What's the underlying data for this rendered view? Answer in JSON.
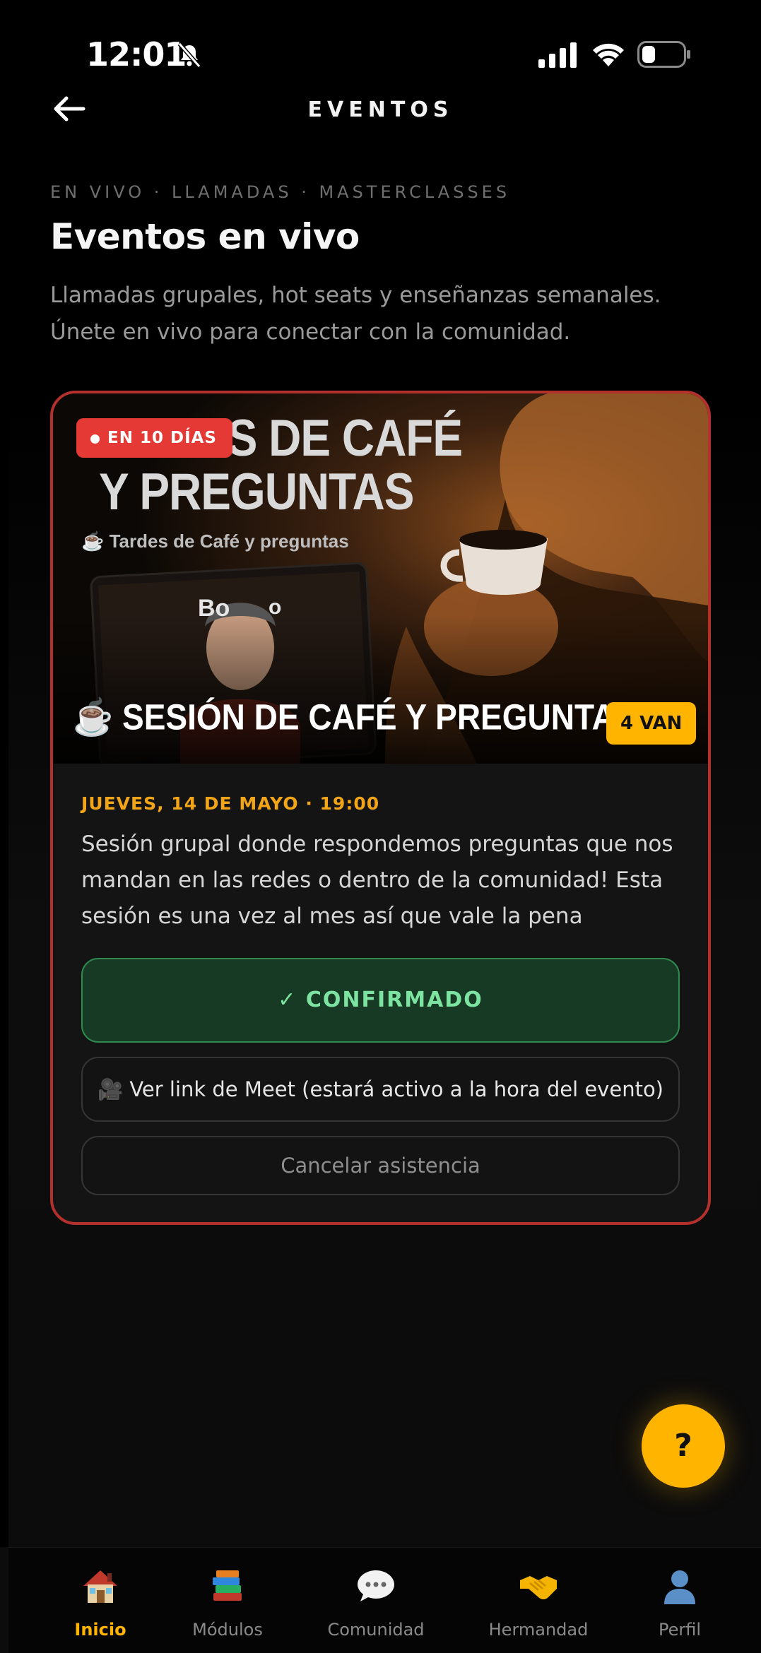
{
  "status": {
    "time": "12:01"
  },
  "header": {
    "title": "EVENTOS"
  },
  "intro": {
    "eyebrow": "EN VIVO · LLAMADAS · MASTERCLASSES",
    "title": "Eventos en vivo",
    "subtitle": "Llamadas grupales, hot seats y enseñanzas semanales. Únete en vivo para conectar con la comunidad."
  },
  "event": {
    "countdown_badge": "EN 10 DÍAS",
    "hero_title_line1": "TARDES DE CAFÉ",
    "hero_title_line2": "Y PREGUNTAS",
    "hero_subtitle": "☕ Tardes de Café y preguntas",
    "hero_session": "☕ SESIÓN DE CAFÉ Y PREGUNTAS",
    "going_badge": "4 VAN",
    "date": "JUEVES, 14 DE MAYO · 19:00",
    "description": "Sesión grupal donde respondemos preguntas que nos mandan en las redes o dentro de la comunidad! Esta sesión es una vez al mes así que vale la pena",
    "confirmed_label": "✓ CONFIRMADO",
    "meet_label": "🎥 Ver link de Meet (estará activo a la hora del evento)",
    "cancel_label": "Cancelar asistencia"
  },
  "fab": {
    "label": "?"
  },
  "tabbar": {
    "items": [
      {
        "label": "Inicio",
        "icon": "house-icon",
        "active": true
      },
      {
        "label": "Módulos",
        "icon": "books-icon",
        "active": false
      },
      {
        "label": "Comunidad",
        "icon": "speech-bubble-icon",
        "active": false
      },
      {
        "label": "Hermandad",
        "icon": "handshake-icon",
        "active": false
      },
      {
        "label": "Perfil",
        "icon": "user-silhouette-icon",
        "active": false
      }
    ]
  },
  "colors": {
    "accent": "#ffb400",
    "card_border": "#b3302d",
    "badge_red": "#e53935",
    "confirmed_green": "#7de3a0"
  }
}
